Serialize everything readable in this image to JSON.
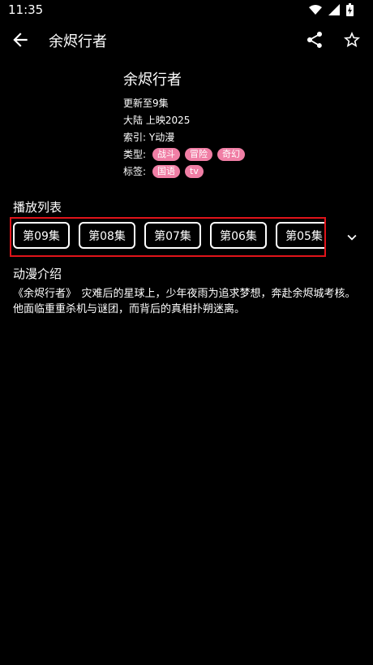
{
  "status_bar": {
    "time": "11:35"
  },
  "app_bar": {
    "title": "余烬行者"
  },
  "anime": {
    "name": "余烬行者",
    "update": "更新至9集",
    "region_year": "大陆  上映2025",
    "index": "索引: Y动漫",
    "type_label": "类型:",
    "types": [
      "战斗",
      "冒险",
      "奇幻"
    ],
    "tags_label": "标签:",
    "tags": [
      "国语",
      "tv"
    ]
  },
  "playlist": {
    "title": "播放列表",
    "episodes": [
      "第09集",
      "第08集",
      "第07集",
      "第06集",
      "第05集"
    ]
  },
  "intro": {
    "title": "动漫介绍",
    "text": "《余烬行者》　灾难后的星球上，少年夜雨为追求梦想，奔赴余烬城考核。他面临重重杀机与谜团，而背后的真相扑朔迷离。"
  }
}
